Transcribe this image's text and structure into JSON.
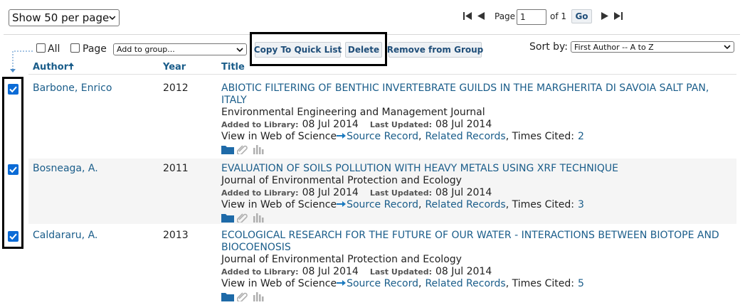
{
  "pager": {
    "per_page": "Show 50 per page",
    "page_label": "Page",
    "page_value": "1",
    "of_label": "of 1",
    "go_label": "Go"
  },
  "toolbar": {
    "all_label": "All",
    "page_label": "Page",
    "group_select": "Add to group...",
    "copy_label": "Copy To Quick List",
    "delete_label": "Delete",
    "remove_label": "Remove from Group",
    "sort_label": "Sort by:",
    "sort_value": "First Author -- A to Z"
  },
  "columns": {
    "author": "Author",
    "year": "Year",
    "title": "Title"
  },
  "labels": {
    "added": "Added to Library:",
    "updated": "Last Updated:",
    "view_in": "View in Web of Science",
    "source": "Source Record",
    "comma": ",",
    "related": "Related Records",
    "times_cited": ", Times Cited:"
  },
  "records": [
    {
      "author": "Barbone, Enrico",
      "year": "2012",
      "title_line1": "ABIOTIC FILTERING OF BENTHIC INVERTEBRATE GUILDS IN THE MARGHERITA DI SAVOIA SALT PAN,",
      "title_line2": "ITALY",
      "journal": "Environmental Engineering and Management Journal",
      "added": "08 Jul 2014",
      "updated": "08 Jul 2014",
      "cited": "2",
      "checked": true
    },
    {
      "author": "Bosneaga, A.",
      "year": "2011",
      "title_line1": "EVALUATION OF SOILS POLLUTION WITH HEAVY METALS USING XRF TECHNIQUE",
      "title_line2": "",
      "journal": "Journal of Environmental Protection and Ecology",
      "added": "08 Jul 2014",
      "updated": "08 Jul 2014",
      "cited": "3",
      "checked": true
    },
    {
      "author": "Caldararu, A.",
      "year": "2013",
      "title_line1": "ECOLOGICAL RESEARCH FOR THE FUTURE OF OUR WATER - INTERACTIONS BETWEEN BIOTOPE AND",
      "title_line2": "BIOCOENOSIS",
      "journal": "Journal of Environmental Protection and Ecology",
      "added": "08 Jul 2014",
      "updated": "08 Jul 2014",
      "cited": "5",
      "checked": true
    }
  ],
  "colors": {
    "link": "#1a5d8a",
    "checkbox": "#0b6bd6",
    "row_alt": "#f5f5f5"
  }
}
